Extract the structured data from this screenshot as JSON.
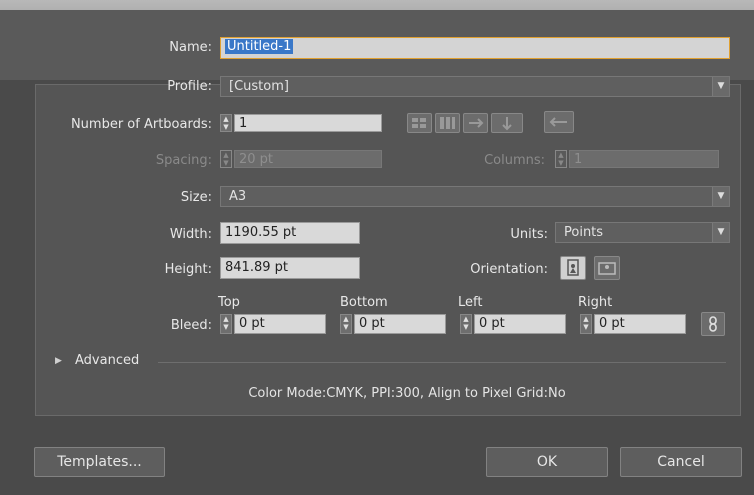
{
  "form": {
    "name_label": "Name:",
    "name_value": "Untitled-1",
    "profile_label": "Profile:",
    "profile_value": "[Custom]",
    "artboards_label": "Number of Artboards:",
    "artboards_value": "1",
    "spacing_label": "Spacing:",
    "spacing_value": "20 pt",
    "columns_label": "Columns:",
    "columns_value": "1",
    "size_label": "Size:",
    "size_value": "A3",
    "width_label": "Width:",
    "width_value": "1190.55 pt",
    "units_label": "Units:",
    "units_value": "Points",
    "height_label": "Height:",
    "height_value": "841.89 pt",
    "orientation_label": "Orientation:",
    "bleed_label": "Bleed:",
    "bleed_top_label": "Top",
    "bleed_bottom_label": "Bottom",
    "bleed_left_label": "Left",
    "bleed_right_label": "Right",
    "bleed_top": "0 pt",
    "bleed_bottom": "0 pt",
    "bleed_left": "0 pt",
    "bleed_right": "0 pt",
    "advanced_label": "Advanced",
    "summary": "Color Mode:CMYK, PPI:300, Align to Pixel Grid:No"
  },
  "buttons": {
    "templates": "Templates...",
    "ok": "OK",
    "cancel": "Cancel"
  },
  "icons": {
    "spin": "spin-arrows-icon",
    "dropdown": "dropdown-arrow-icon",
    "grid_by_row": "grid-by-row-icon",
    "grid_by_column": "grid-by-column-icon",
    "arrange_by_row": "arrange-by-row-icon",
    "arrange_by_column": "arrange-by-column-icon",
    "rtl_layout": "right-to-left-layout-icon",
    "portrait": "portrait-orientation-icon",
    "landscape": "landscape-orientation-icon",
    "link": "link-bleed-icon",
    "disclosure": "disclosure-triangle-icon"
  }
}
